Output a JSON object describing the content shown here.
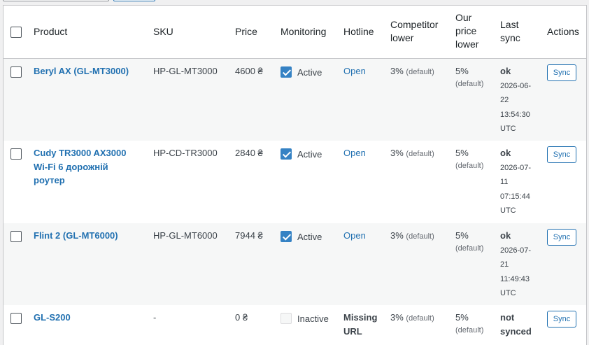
{
  "header": {
    "product": "Product",
    "sku": "SKU",
    "price": "Price",
    "monitoring": "Monitoring",
    "hotline": "Hotline",
    "competitor_lower_1": "Competitor",
    "competitor_lower_2": "lower",
    "our_price_lower_1": "Our",
    "our_price_lower_2": "price",
    "our_price_lower_3": "lower",
    "last_sync_1": "Last",
    "last_sync_2": "sync",
    "actions": "Actions"
  },
  "rows": [
    {
      "name_1": "Beryl AX (GL-MT3000)",
      "sku": "HP-GL-MT3000",
      "price": "4600 ₴",
      "monitoring_checked": true,
      "monitoring_label": "Active",
      "hotline": "Open",
      "competitor_value": "3%",
      "competitor_note": "(default)",
      "our_value": "5%",
      "our_note": "(default)",
      "sync_status": "ok",
      "sync_ts_1": "2026-06-",
      "sync_ts_2": "22",
      "sync_ts_3": "13:54:30",
      "sync_ts_4": "UTC",
      "action": "Sync"
    },
    {
      "name_1": "Cudy TR3000 AX3000",
      "name_2": "Wi-Fi 6 дорожній",
      "name_3": "роутер",
      "sku": "HP-CD-TR3000",
      "price": "2840 ₴",
      "monitoring_checked": true,
      "monitoring_label": "Active",
      "hotline": "Open",
      "competitor_value": "3%",
      "competitor_note": "(default)",
      "our_value": "5%",
      "our_note": "(default)",
      "sync_status": "ok",
      "sync_ts_1": "2026-07-",
      "sync_ts_2": "11",
      "sync_ts_3": "07:15:44",
      "sync_ts_4": "UTC",
      "action": "Sync"
    },
    {
      "name_1": "Flint 2 (GL-MT6000)",
      "sku": "HP-GL-MT6000",
      "price": "7944 ₴",
      "monitoring_checked": true,
      "monitoring_label": "Active",
      "hotline": "Open",
      "competitor_value": "3%",
      "competitor_note": "(default)",
      "our_value": "5%",
      "our_note": "(default)",
      "sync_status": "ok",
      "sync_ts_1": "2026-07-",
      "sync_ts_2": "21",
      "sync_ts_3": "11:49:43",
      "sync_ts_4": "UTC",
      "action": "Sync"
    },
    {
      "name_1": "GL-S200",
      "sku": "-",
      "price": "0 ₴",
      "monitoring_checked": false,
      "monitoring_label": "Inactive",
      "hotline_1": "Missing",
      "hotline_2": "URL",
      "competitor_value": "3%",
      "competitor_note": "(default)",
      "our_value": "5%",
      "our_note": "(default)",
      "sync_status_1": "not",
      "sync_status_2": "synced",
      "action": "Sync"
    }
  ]
}
